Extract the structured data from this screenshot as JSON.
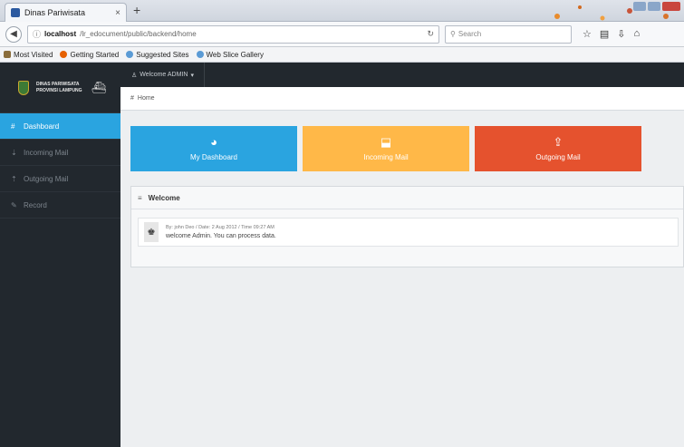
{
  "browser": {
    "tab_title": "Dinas Pariwisata",
    "tab_close": "×",
    "new_tab": "+",
    "url_host": "localhost",
    "url_path": "/lr_edocument/public/backend/home",
    "search_placeholder": "Search",
    "bookmarks": [
      {
        "label": "Most Visited",
        "color": "#8a6d3b"
      },
      {
        "label": "Getting Started",
        "color": "#e66000"
      },
      {
        "label": "Suggested Sites",
        "color": "#5b9bd5"
      },
      {
        "label": "Web Slice Gallery",
        "color": "#5b9bd5"
      }
    ]
  },
  "app": {
    "brand_line1": "DINAS PARIWISATA",
    "brand_line2": "PROVINSI LAMPUNG",
    "user_menu": "Welcome ADMIN",
    "breadcrumb": "Home",
    "sidebar": [
      {
        "label": "Dashboard",
        "icon": "#"
      },
      {
        "label": "Incoming Mail",
        "icon": "⇣"
      },
      {
        "label": "Outgoing Mail",
        "icon": "⇡"
      },
      {
        "label": "Record",
        "icon": "✎"
      }
    ],
    "tiles": [
      {
        "label": "My Dashboard",
        "icon": "◕",
        "color": "#2aa4e0"
      },
      {
        "label": "Incoming Mail",
        "icon": "⬓",
        "color": "#ffb848"
      },
      {
        "label": "Outgoing Mail",
        "icon": "⇪",
        "color": "#e5522e"
      }
    ],
    "panel": {
      "title": "Welcome",
      "meta": "By: john Deo / Date: 2 Aug 2012 / Time 09:27 AM",
      "message": "welcome Admin. You can process data."
    }
  }
}
